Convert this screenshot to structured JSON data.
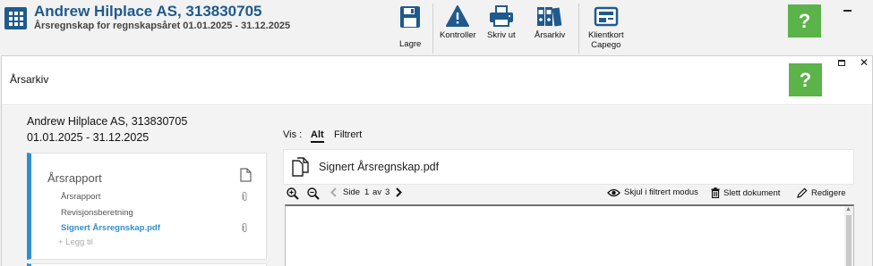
{
  "header": {
    "company": "Andrew Hilplace AS, 313830705",
    "subtitle": "Årsregnskap for regnskapsåret 01.01.2025 - 31.12.2025"
  },
  "toolbar": {
    "save": "Lagre",
    "check": "Kontroller",
    "print": "Skriv ut",
    "archive": "Årsarkiv",
    "client_card_line1": "Klientkort",
    "client_card_line2": "Capego"
  },
  "help_label": "?",
  "dialog": {
    "title": "Årsarkiv",
    "close": "✕",
    "company": "Andrew Hilplace AS, 313830705",
    "period": "01.01.2025 - 31.12.2025",
    "vis_label": "Vis :",
    "vis_all": "Alt",
    "vis_filtered": "Filtrert",
    "card": {
      "title": "Årsrapport",
      "items": [
        "Årsrapport",
        "Revisjonsberetning",
        "Signert Årsregnskap.pdf"
      ],
      "add": "+ Legg til"
    },
    "file_name": "Signert Årsregnskap.pdf",
    "viewer": {
      "page_label": "Side",
      "page_current": "1",
      "page_of": "av",
      "page_total": "3",
      "hide_filtered": "Skjul i filtrert modus",
      "delete_doc": "Slett dokument",
      "edit": "Rediger",
      "edit_suffix": "e"
    }
  },
  "colors": {
    "brand_blue": "#1f5a8c",
    "accent_blue": "#2f8fce",
    "help_green": "#5bb34a"
  }
}
